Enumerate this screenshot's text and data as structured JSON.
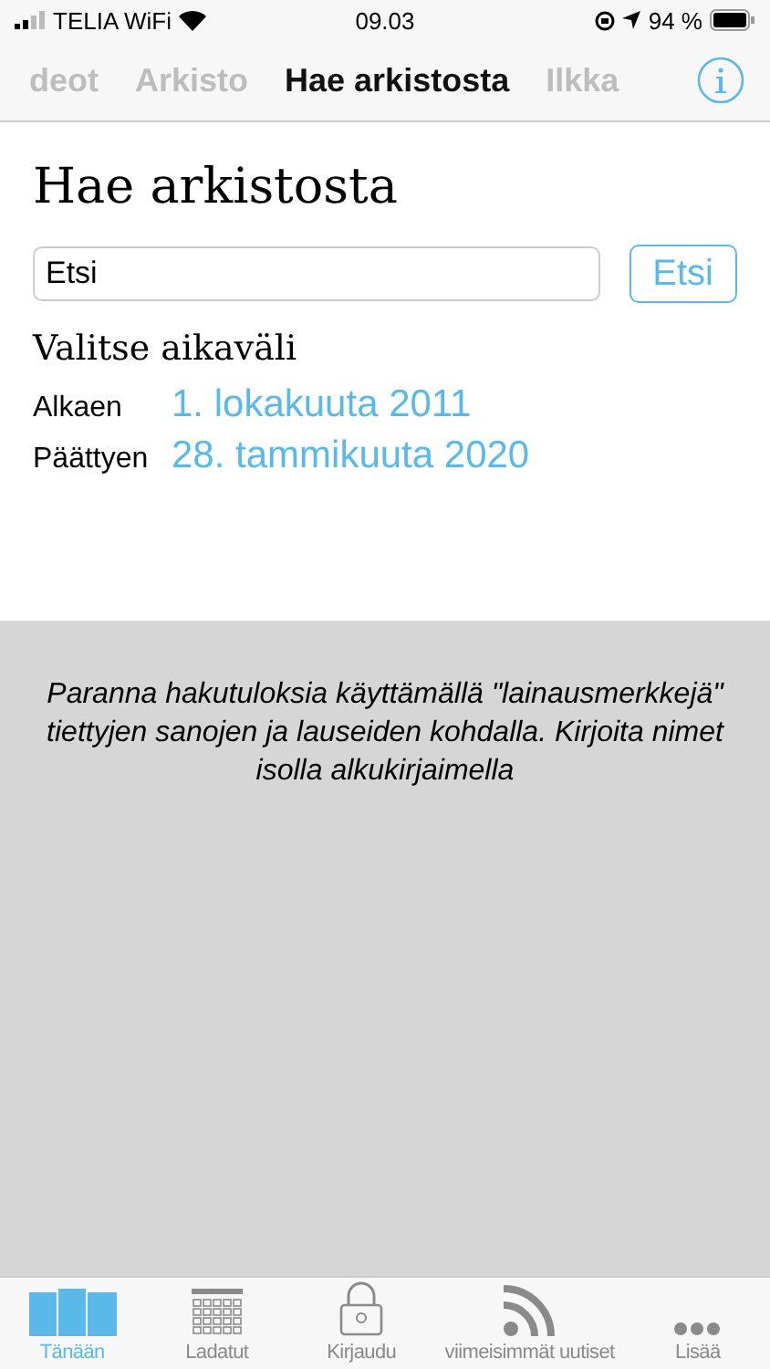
{
  "status_bar": {
    "carrier": "TELIA WiFi",
    "time": "09.03",
    "battery": "94 %"
  },
  "nav_tabs": [
    {
      "label": "deot",
      "selected": false
    },
    {
      "label": "Arkisto",
      "selected": false
    },
    {
      "label": "Hae arkistosta",
      "selected": true
    },
    {
      "label": "Ilkka",
      "selected": false
    }
  ],
  "title": "Hae arkistosta",
  "search": {
    "value": "Etsi",
    "button": "Etsi"
  },
  "range": {
    "heading": "Valitse aikaväli",
    "rows": [
      {
        "label": "Alkaen",
        "date": "1. lokakuuta 2011"
      },
      {
        "label": "Päättyen",
        "date": "28. tammikuuta 2020"
      }
    ]
  },
  "hint": "Paranna hakutuloksia käyttämällä \"lainausmerkkejä\" tiettyjen sanojen ja lauseiden kohdalla. Kirjoita nimet isolla alkukirjaimella",
  "tab_bar": [
    {
      "label": "Tänään",
      "kind": "pages",
      "selected": true
    },
    {
      "label": "Ladatut",
      "kind": "calendar",
      "selected": false
    },
    {
      "label": "Kirjaudu",
      "kind": "lock",
      "selected": false
    },
    {
      "label": "viimeisimmät uutiset",
      "kind": "feed",
      "selected": false
    },
    {
      "label": "Lisää",
      "kind": "more",
      "selected": false
    }
  ]
}
